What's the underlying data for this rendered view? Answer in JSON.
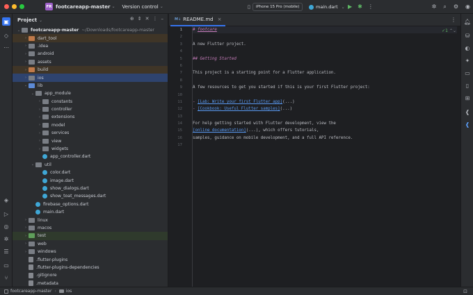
{
  "titlebar": {
    "project_badge": "FR",
    "project_name": "footcareapp-master",
    "version_control": "Version control",
    "device": "iPhone 15 Pro (mobile)",
    "run_config": "main.dart"
  },
  "project_panel": {
    "title": "Project",
    "root_name": "footcareapp-master",
    "root_path": "~/Downloads/footcareapp-master",
    "items": [
      {
        "label": "dart_tool"
      },
      {
        "label": ".idea"
      },
      {
        "label": "android"
      },
      {
        "label": "assets"
      },
      {
        "label": "build"
      },
      {
        "label": "ios"
      },
      {
        "label": "lib"
      },
      {
        "label": "app_module"
      },
      {
        "label": "constants"
      },
      {
        "label": "controller"
      },
      {
        "label": "extensions"
      },
      {
        "label": "model"
      },
      {
        "label": "services"
      },
      {
        "label": "view"
      },
      {
        "label": "widgets"
      },
      {
        "label": "app_controller.dart"
      },
      {
        "label": "util"
      },
      {
        "label": "color.dart"
      },
      {
        "label": "image.dart"
      },
      {
        "label": "show_dialogs.dart"
      },
      {
        "label": "show_toat_messages.dart"
      },
      {
        "label": "firebase_options.dart"
      },
      {
        "label": "main.dart"
      },
      {
        "label": "linux"
      },
      {
        "label": "macos"
      },
      {
        "label": "test"
      },
      {
        "label": "web"
      },
      {
        "label": "windows"
      },
      {
        "label": ".flutter-plugins"
      },
      {
        "label": ".flutter-plugins-dependencies"
      },
      {
        "label": ".gitignore"
      },
      {
        "label": ".metadata"
      }
    ]
  },
  "editor": {
    "tab_label": "README.md",
    "tab_type": "M↓",
    "check_count": "1",
    "line_numbers": [
      "1",
      "2",
      "3",
      "4",
      "5",
      "6",
      "7",
      "8",
      "9",
      "10",
      "11",
      "12",
      "13",
      "14",
      "15",
      "16",
      "17"
    ],
    "lines": {
      "l1_hash": "# ",
      "l1_title": "footcare",
      "l3": "A new Flutter project.",
      "l5": "## Getting Started",
      "l7": "This project is a starting point for a Flutter application.",
      "l9": "A few resources to get you started if this is your first Flutter project:",
      "l11_dash": "- ",
      "l11_link": "[Lab: Write your first Flutter app]",
      "l11_paren": "(...)",
      "l12_dash": "- ",
      "l12_link": "[Cookbook: Useful Flutter samples]",
      "l12_paren": "(...)",
      "l14": "For help getting started with Flutter development, view the",
      "l15_link": "[online documentation]",
      "l15_rest": "(...), which offers tutorials,",
      "l16": "samples, guidance on mobile development, and a full API reference."
    }
  },
  "statusbar": {
    "project": "footcareapp-master",
    "folder": "ios"
  },
  "colors": {
    "accent": "#3574f0",
    "project_badge": "#9d5fc8",
    "markdown_heading": "#c77dbb",
    "link": "#5a9bf4"
  }
}
